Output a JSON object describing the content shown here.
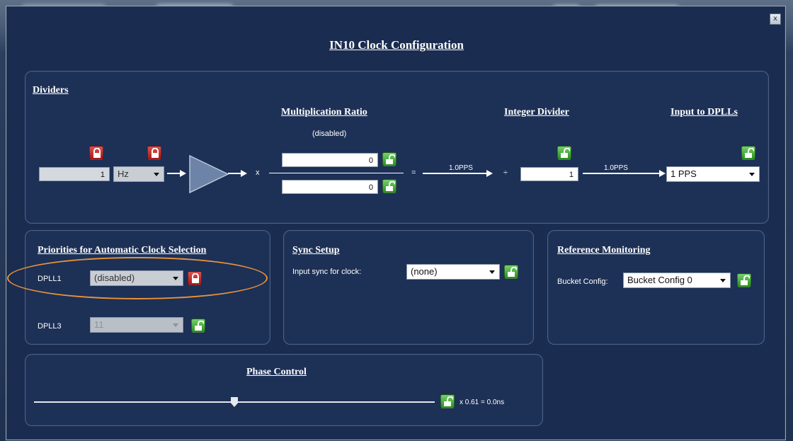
{
  "window": {
    "title": "IN10 Clock Configuration",
    "close_label": "x"
  },
  "dividers": {
    "header": "Dividers",
    "input_value": "1",
    "unit_select": "Hz",
    "multiplication_header": "Multiplication Ratio",
    "multiplication_status": "(disabled)",
    "numerator": "0",
    "denominator": "0",
    "times_symbol": "x",
    "equals_symbol": "=",
    "rate_label_1": "1.0PPS",
    "divide_symbol": "÷",
    "integer_divider_header": "Integer Divider",
    "integer_divider_value": "1",
    "rate_label_2": "1.0PPS",
    "input_to_dplls_header": "Input to DPLLs",
    "dpll_input_select": "1 PPS"
  },
  "priorities": {
    "header": "Priorities for Automatic Clock Selection",
    "dpll1_label": "DPLL1",
    "dpll1_value": "(disabled)",
    "dpll3_label": "DPLL3",
    "dpll3_value": "11"
  },
  "sync": {
    "header": "Sync Setup",
    "label": "Input sync for clock:",
    "value": "(none)"
  },
  "reference": {
    "header": "Reference Monitoring",
    "label": "Bucket Config:",
    "value": "Bucket Config 0"
  },
  "phase": {
    "header": "Phase Control",
    "readout": "x 0.61 = 0.0ns",
    "slider_fraction": 0.5
  },
  "colors": {
    "lock_locked": "#b3231f",
    "lock_unlocked": "#3aa02c",
    "highlight_oval": "#e8923a",
    "panel_bg": "#1d3056"
  }
}
